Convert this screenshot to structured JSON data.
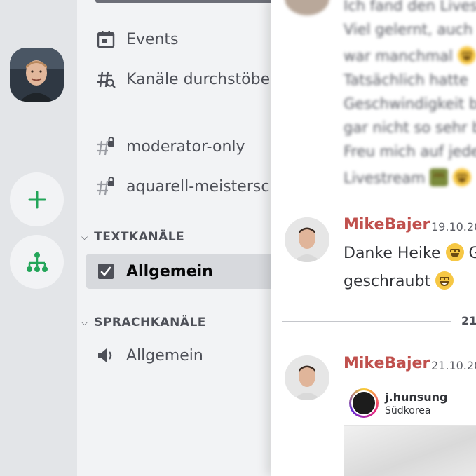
{
  "rail": {
    "server_avatar": "user-photo",
    "add_icon": "plus-icon",
    "discover_icon": "hierarchy-icon"
  },
  "channels": {
    "nav": [
      {
        "label": "Events",
        "icon": "calendar-icon"
      },
      {
        "label": "Kanäle durchstöbern",
        "icon": "hash-search-icon"
      }
    ],
    "private": [
      {
        "label": "moderator-only",
        "icon": "hash-lock-icon"
      },
      {
        "label": "aquarell-meisterschaft",
        "icon": "hash-lock-icon"
      }
    ],
    "text_category": "TEXTKANÄLE",
    "text_channels": [
      {
        "label": "Allgemein",
        "icon": "checkbox-icon",
        "active": true
      }
    ],
    "voice_category": "SPRACHKANÄLE",
    "voice_channels": [
      {
        "label": "Allgemein",
        "icon": "speaker-icon"
      }
    ]
  },
  "chat": {
    "blurred_lines": [
      "Ich fand den Livestream",
      "Viel gelernt, auch",
      "war manchmal",
      "Tatsächlich hatte",
      "Geschwindigkeit b",
      "gar nicht so sehr b",
      "Freu mich auf jede",
      "Livestream"
    ],
    "messages": [
      {
        "author": "MikeBajer",
        "timestamp": "19.10.20",
        "lines": [
          "Danke Heike",
          "geschraubt"
        ]
      },
      {
        "author": "MikeBajer",
        "timestamp": "21.10.20",
        "embed": {
          "name": "j.hunsung",
          "location": "Südkorea"
        }
      }
    ],
    "date_divider": "21."
  },
  "colors": {
    "author": "#c0504d",
    "rail_bg": "#e3e5e8",
    "channel_bg": "#f2f3f5",
    "green_accent": "#23a559"
  }
}
